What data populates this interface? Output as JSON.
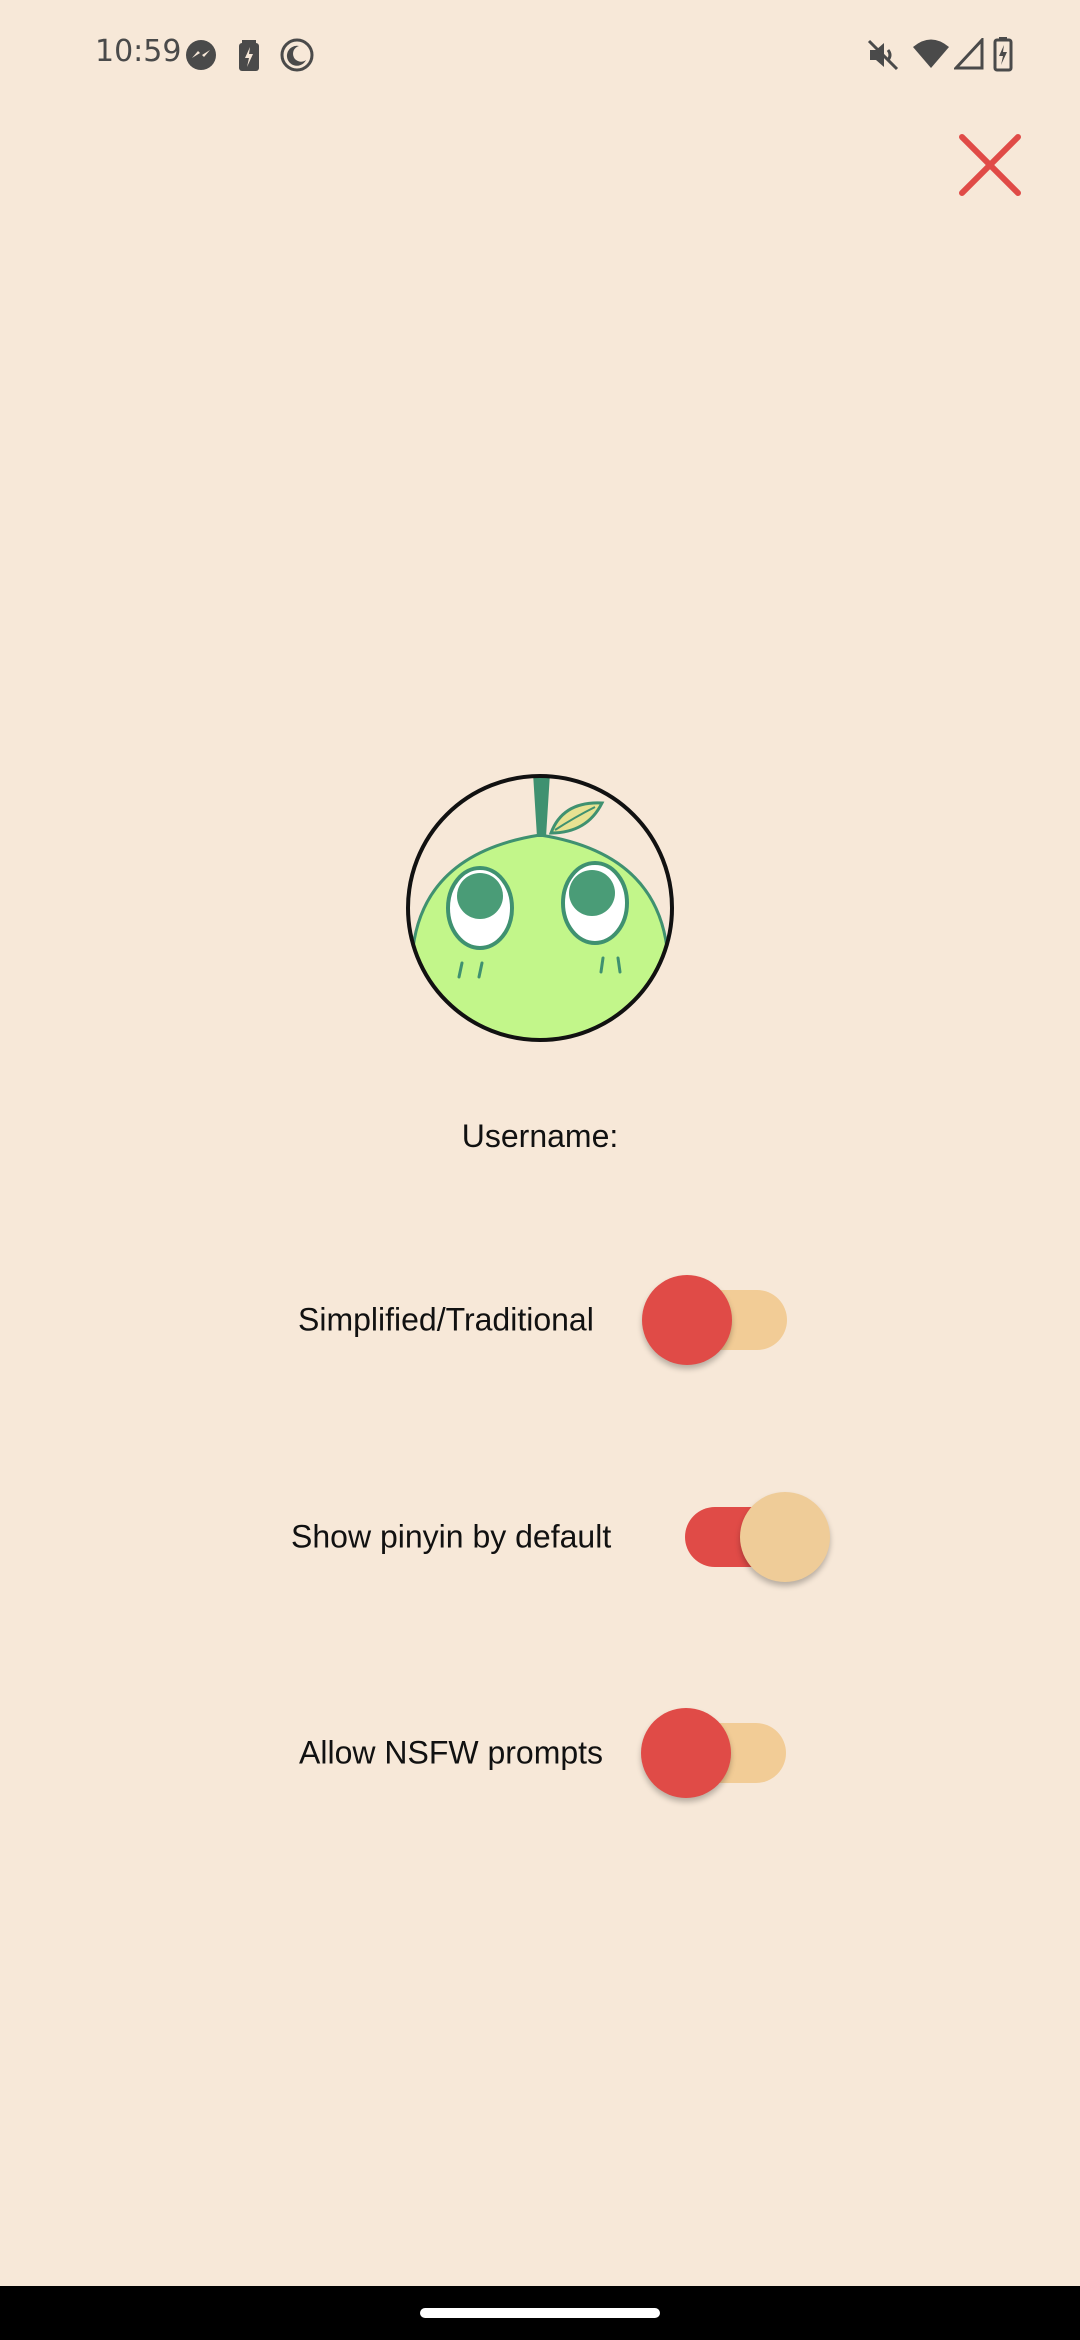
{
  "status_bar": {
    "time": "10:59",
    "left_icons": [
      "messenger-icon",
      "battery-saver-icon",
      "moon-icon"
    ],
    "right_icons": [
      "mute-icon",
      "wifi-icon",
      "signal-icon",
      "battery-icon"
    ]
  },
  "header": {
    "close_icon": "close-icon",
    "close_color": "#e04b47"
  },
  "profile": {
    "avatar": "apple-character-avatar",
    "username_label": "Username:"
  },
  "settings": [
    {
      "label": "Simplified/Traditional",
      "on": false
    },
    {
      "label": "Show pinyin by default",
      "on": true
    },
    {
      "label": "Allow NSFW prompts",
      "on": false
    }
  ],
  "colors": {
    "background": "#f7e8d8",
    "accent_red": "#e04b47",
    "track_light": "#f2cc96",
    "thumb_light": "#efcc98"
  }
}
